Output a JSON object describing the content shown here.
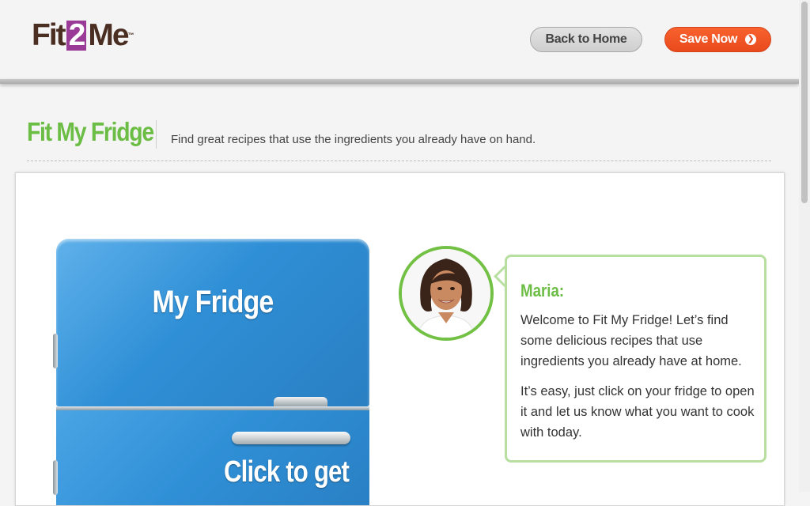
{
  "header": {
    "logo": {
      "part1": "Fit",
      "part2": "2",
      "part3": "Me",
      "tm": "™"
    },
    "back_label": "Back to Home",
    "save_label": "Save Now"
  },
  "page": {
    "title": "Fit My Fridge",
    "subtitle": "Find great recipes that use the ingredients you already have on hand."
  },
  "fridge": {
    "label": "My Fridge",
    "cta": "Click to get"
  },
  "chat": {
    "speaker": "Maria:",
    "message1": "Welcome to Fit My Fridge! Let’s find some delicious recipes that use ingredients you already have at home.",
    "message2": "It’s easy, just click on your fridge to open it and let us know what you want to cook with today."
  },
  "colors": {
    "brand_green": "#6cbd45",
    "brand_orange": "#e94a1c",
    "fridge_blue": "#2f8fd6",
    "logo_brown": "#4a2e22",
    "logo_purple": "#9a3c97"
  },
  "icons": {
    "save_arrow": "chevron-right-circle-icon",
    "avatar": "maria-avatar"
  }
}
